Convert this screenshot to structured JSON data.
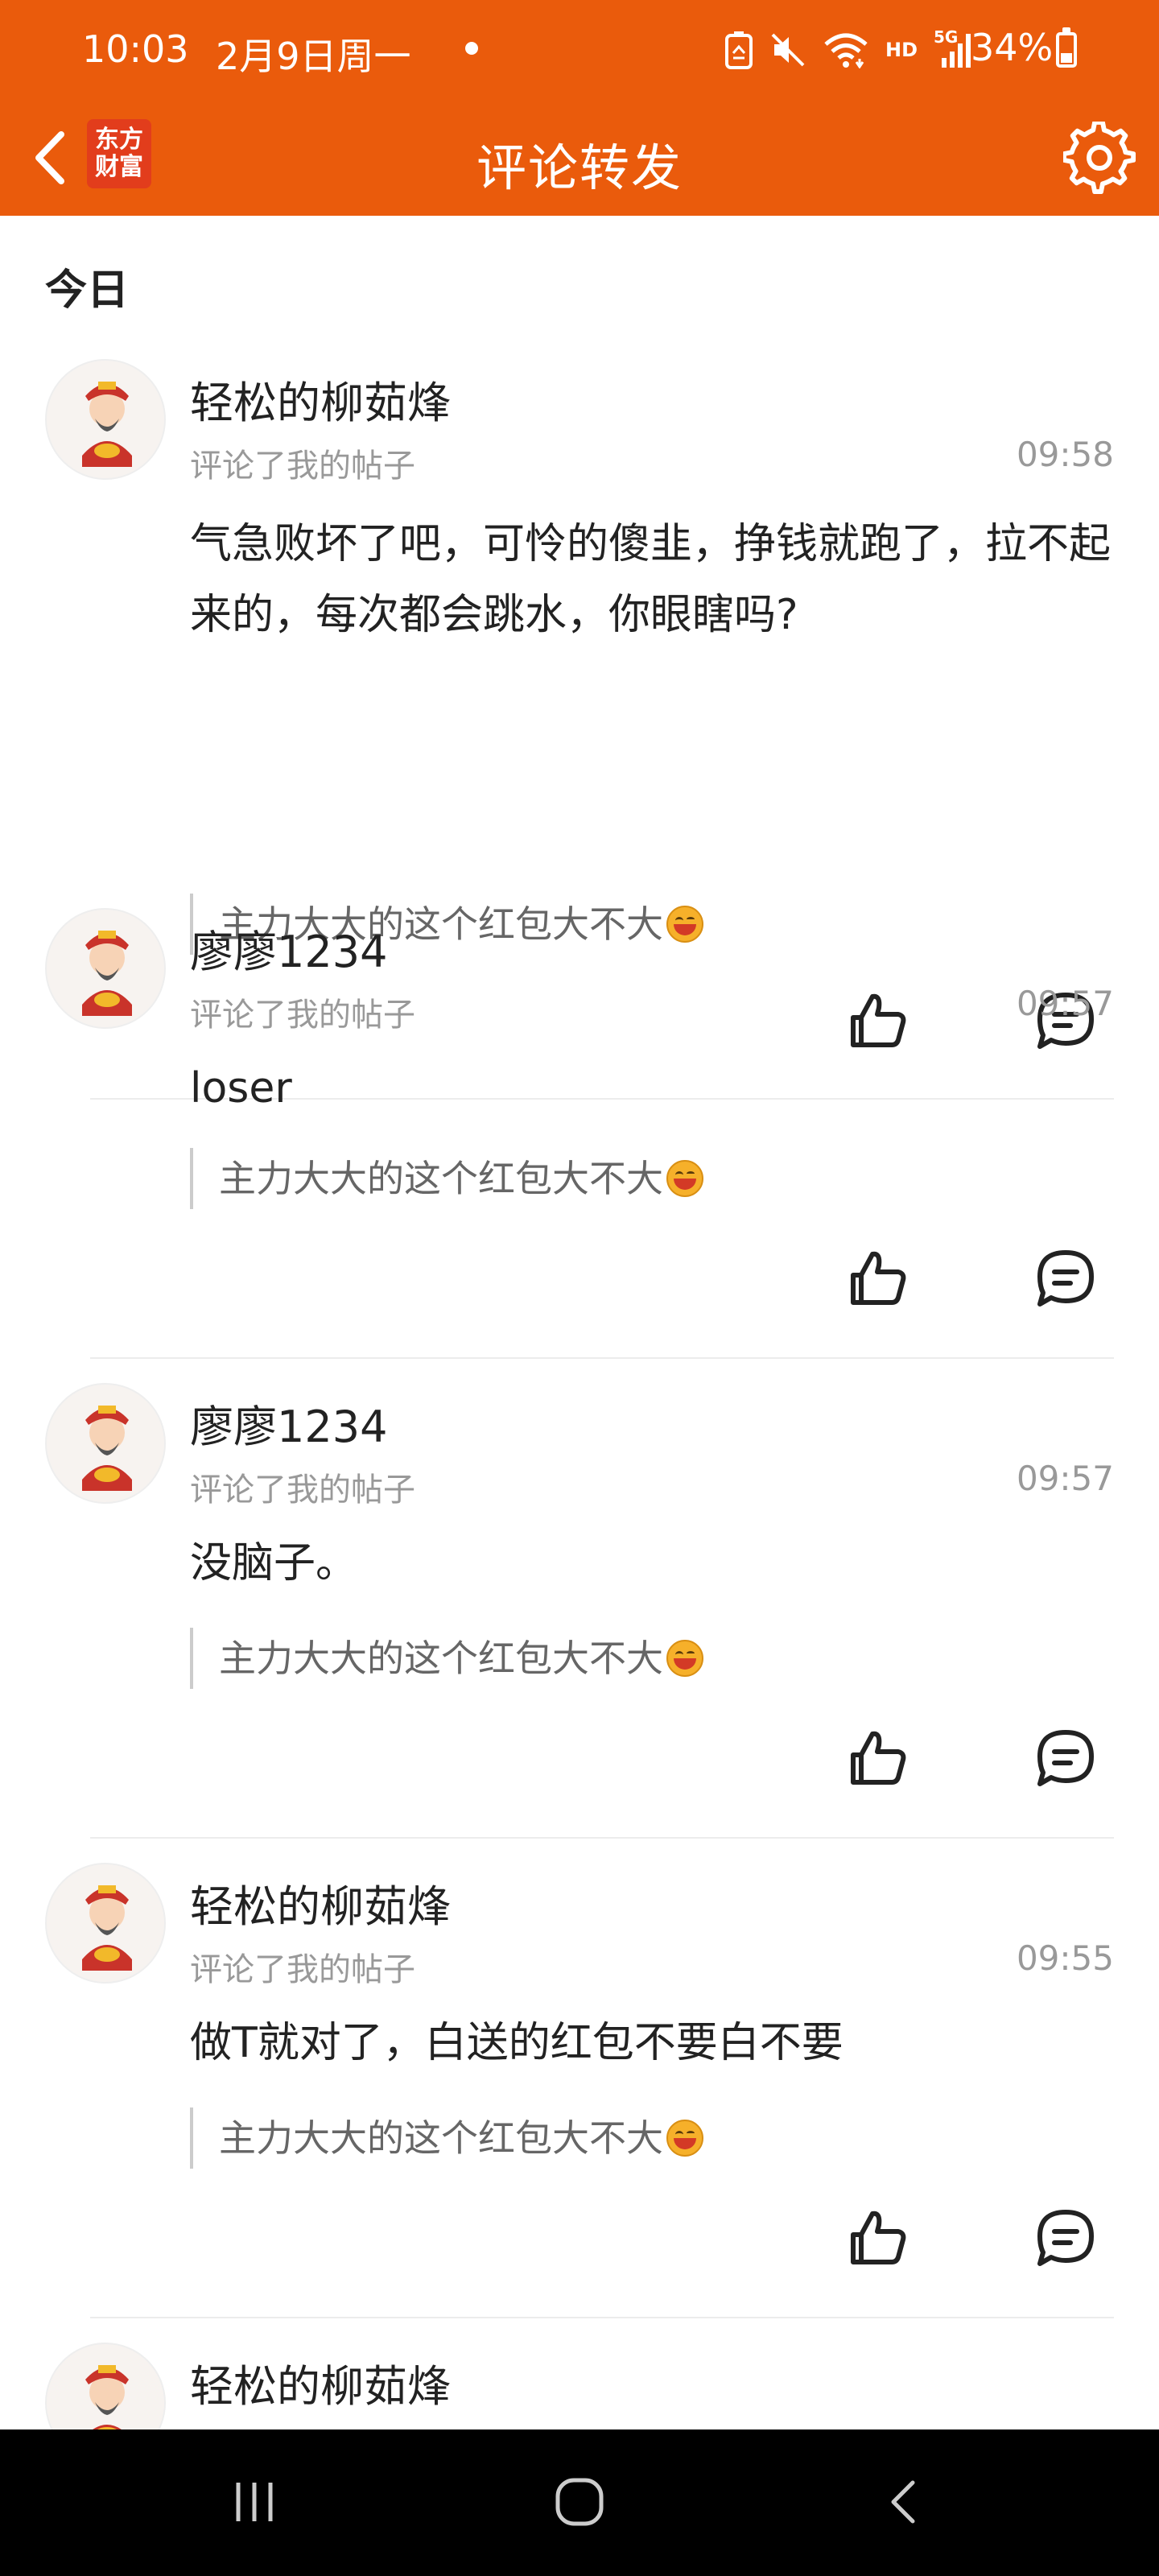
{
  "status_bar": {
    "time": "10:03",
    "date": "2月9日周一",
    "signal_label": "HD",
    "network": "5G",
    "battery_percent": "34%",
    "icons": [
      "recycle-notification-icon",
      "mute-icon",
      "wifi-icon",
      "signal-icon",
      "battery-icon"
    ]
  },
  "header": {
    "title": "评论转发",
    "logo_line1": "东方",
    "logo_line2": "财富",
    "back_icon": "chevron-left-icon",
    "settings_icon": "gear-icon",
    "background_color": "#ea5b0c"
  },
  "section": {
    "label": "今日"
  },
  "comments": [
    {
      "user": "轻松的柳茹烽",
      "action": "评论了我的帖子",
      "time": "09:58",
      "text": "气急败坏了吧，可怜的傻韭，挣钱就跑了，拉不起来的，每次都会跳水，你眼瞎吗?",
      "quote": "主力大大的这个红包大不大"
    },
    {
      "user": "廖廖1234",
      "action": "评论了我的帖子",
      "time": "09:57",
      "text": "loser",
      "quote": "主力大大的这个红包大不大"
    },
    {
      "user": "廖廖1234",
      "action": "评论了我的帖子",
      "time": "09:57",
      "text": "没脑子。",
      "quote": "主力大大的这个红包大不大"
    },
    {
      "user": "轻松的柳茹烽",
      "action": "评论了我的帖子",
      "time": "09:55",
      "text": "做T就对了，白送的红包不要白不要",
      "quote": "主力大大的这个红包大不大"
    },
    {
      "user": "轻松的柳茹烽",
      "action": "",
      "time": "",
      "text": "",
      "quote": ""
    }
  ],
  "nav_bar": {
    "icons": [
      "recent-apps-icon",
      "home-icon",
      "back-icon"
    ]
  }
}
